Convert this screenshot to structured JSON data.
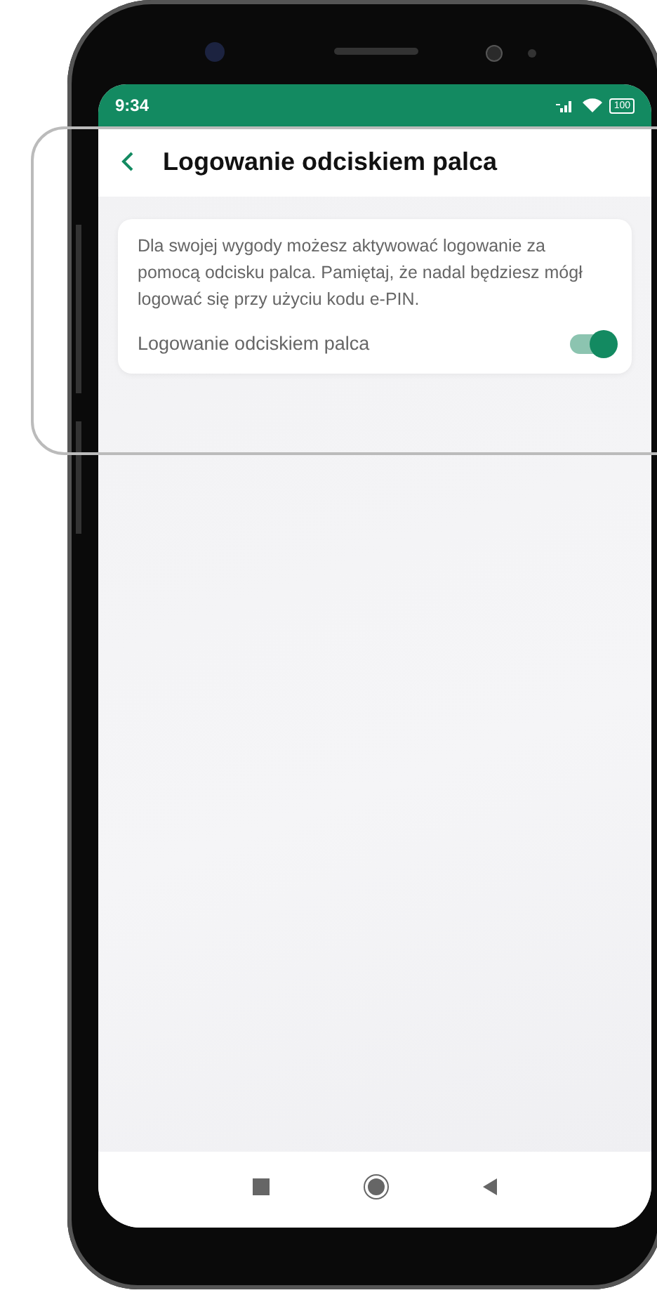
{
  "status_bar": {
    "time": "9:34",
    "battery": "100"
  },
  "header": {
    "title": "Logowanie odciskiem palca"
  },
  "card": {
    "description": "Dla swojej wygody możesz aktywować logowanie za pomocą odcisku palca. Pamiętaj, że nadal będziesz mógł logować się przy użyciu kodu e-PIN.",
    "toggle": {
      "label": "Logowanie odciskiem palca",
      "on": true
    }
  }
}
